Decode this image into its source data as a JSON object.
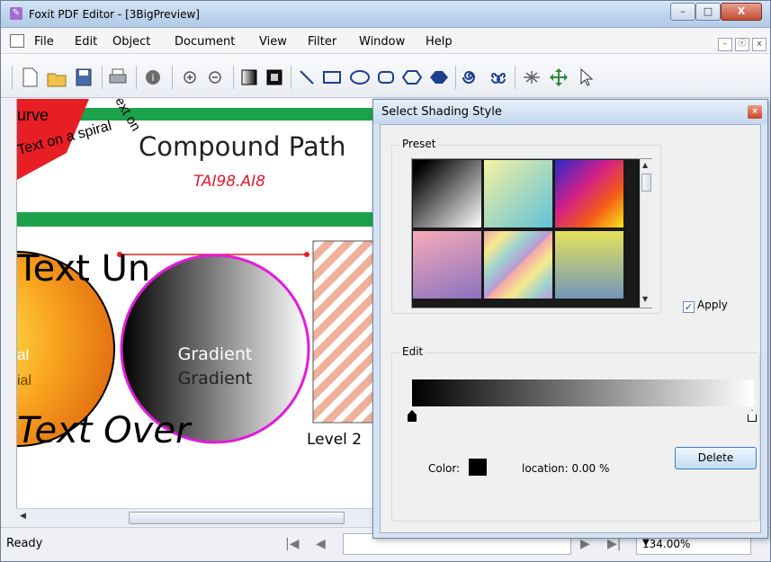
{
  "window": {
    "title": "Foxit PDF Editor - [3BigPreview]",
    "minimize": "–",
    "maximize": "□",
    "close": "X"
  },
  "menu": {
    "items": [
      "File",
      "Edit",
      "Object",
      "Document",
      "View",
      "Filter",
      "Window",
      "Help"
    ],
    "mdi_minimize": "–",
    "mdi_restore": "ⓡ",
    "mdi_close": "x"
  },
  "toolbar": {
    "icons": [
      "new-document-icon",
      "open-folder-icon",
      "save-icon",
      "print-icon",
      "info-icon",
      "zoom-in-icon",
      "zoom-out-icon",
      "shading-icon",
      "fill-icon",
      "line-icon",
      "rectangle-icon",
      "ellipse-icon",
      "rounded-rectangle-icon",
      "hexagon-icon",
      "diamond-icon",
      "spiral-icon",
      "double-spiral-icon",
      "sparkle-icon",
      "move-icon",
      "select-arrow-icon"
    ]
  },
  "canvas": {
    "curve_label": "urve",
    "compound_path": "Compound Path",
    "file_label": "TAI98.AI8",
    "text_under": "Text Un",
    "gradient_1": "Gradient",
    "gradient_2": "Gradient",
    "text_over": "Text Over",
    "level_label": "Level 2",
    "side_al": "al",
    "side_ial": "ial",
    "spiral_text": "Text on a spiral"
  },
  "status": {
    "text": "Ready",
    "zoom": "134.00%"
  },
  "dialog": {
    "title": "Select Shading Style",
    "preset_label": "Preset",
    "apply_label": "Apply",
    "apply_checked": true,
    "edit_label": "Edit",
    "color_label": "Color:",
    "color_value": "#000000",
    "location_label": "location: 0.00  %",
    "delete_label": "Delete",
    "presets": [
      {
        "name": "black-white-diagonal",
        "colors": [
          "#000000",
          "#ffffff"
        ]
      },
      {
        "name": "yellow-cyan",
        "colors": [
          "#f5f3a6",
          "#6fc3d6"
        ]
      },
      {
        "name": "rainbow",
        "colors": [
          "#3030d0",
          "#d0208a",
          "#f55b16",
          "#f5e81a"
        ]
      },
      {
        "name": "pink-violet",
        "colors": [
          "#f39fb7",
          "#8d6fbd"
        ]
      },
      {
        "name": "pastel-stripes",
        "colors": [
          "#f2a4ac",
          "#f7e98c",
          "#9fd3d0",
          "#b897d6"
        ]
      },
      {
        "name": "yellow-blue",
        "colors": [
          "#e5e15c",
          "#7897b5"
        ]
      }
    ]
  }
}
